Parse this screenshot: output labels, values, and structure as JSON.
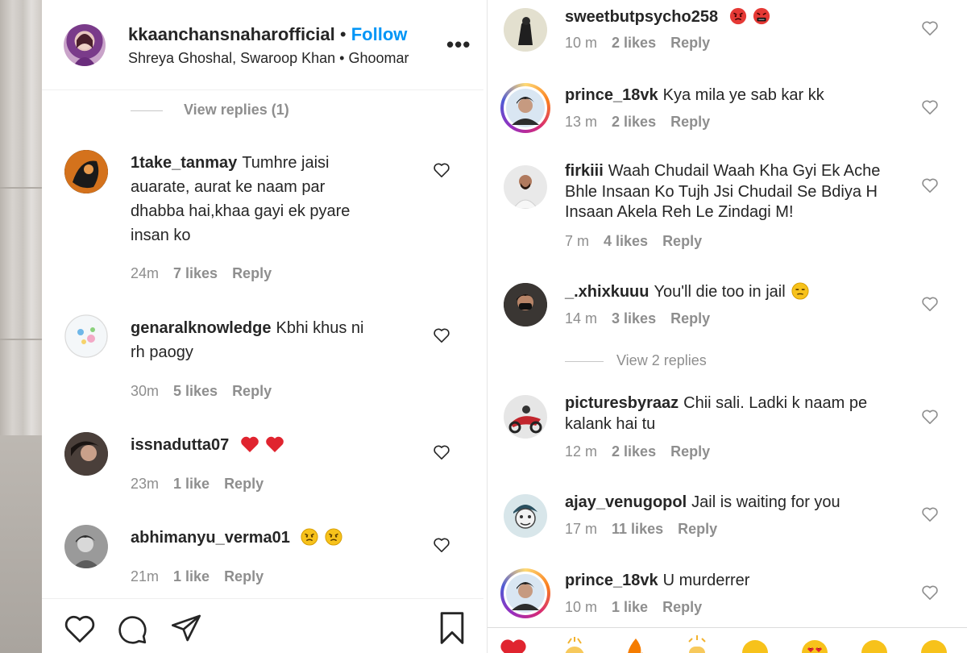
{
  "left": {
    "post": {
      "username": "kkaanchansnaharofficial",
      "separator": "•",
      "follow_label": "Follow",
      "audio": "Shreya Ghoshal, Swaroop Khan • Ghoomar",
      "more": "•••"
    },
    "view_replies": "View replies (1)",
    "comments": [
      {
        "user": "1take_tanmay",
        "text": "Tumhre jaisi",
        "lines": [
          "auarate, aurat ke naam par",
          "dhabba hai,khaa gayi ek pyare",
          "insan ko"
        ],
        "time": "24m",
        "likes": "7 likes",
        "reply": "Reply"
      },
      {
        "user": "genaralknowledge",
        "text": "Kbhi khus ni",
        "lines": [
          "rh paogy"
        ],
        "time": "30m",
        "likes": "5 likes",
        "reply": "Reply"
      },
      {
        "user": "issnadutta07",
        "text": "",
        "emoji": [
          "heart-emoji",
          "heart-emoji"
        ],
        "time": "23m",
        "likes": "1 like",
        "reply": "Reply"
      },
      {
        "user": "abhimanyu_verma01",
        "text": "",
        "emoji": [
          "angry-face-emoji",
          "angry-face-emoji"
        ],
        "time": "21m",
        "likes": "1 like",
        "reply": "Reply"
      }
    ],
    "actions": [
      "heart-icon",
      "comment-icon",
      "send-icon",
      "bookmark-icon"
    ]
  },
  "right": {
    "comments": [
      {
        "user": "sweetbutpsycho258",
        "text": "",
        "emoji": [
          "red-angry-face-emoji",
          "cursing-face-emoji"
        ],
        "time": "10 m",
        "likes": "2 likes",
        "reply": "Reply"
      },
      {
        "user": "prince_18vk",
        "text": "Kya mila ye sab kar kk",
        "time": "13 m",
        "likes": "2 likes",
        "reply": "Reply"
      },
      {
        "user": "firkiii",
        "text": "Waah Chudail Waah Kha Gyi Ek Ache",
        "lines": [
          "Bhle Insaan Ko Tujh Jsi Chudail Se Bdiya H",
          "Insaan Akela Reh Le Zindagi M!"
        ],
        "time": "7 m",
        "likes": "4 likes",
        "reply": "Reply"
      },
      {
        "user": "_.xhixkuuu",
        "text": "You'll die too in jail",
        "emoji": [
          "unamused-face-emoji"
        ],
        "time": "14 m",
        "likes": "3 likes",
        "reply": "Reply"
      },
      {
        "user": "picturesbyraaz",
        "text": "Chii sali. Ladki k naam pe",
        "lines": [
          "kalank hai tu"
        ],
        "time": "12 m",
        "likes": "2 likes",
        "reply": "Reply"
      },
      {
        "user": "ajay_venugopol",
        "text": "Jail is waiting for you",
        "time": "17 m",
        "likes": "11 likes",
        "reply": "Reply"
      },
      {
        "user": "prince_18vk",
        "text": "U murderrer",
        "time": "10 m",
        "likes": "1 like",
        "reply": "Reply"
      }
    ],
    "view_replies": "View 2 replies"
  },
  "colors": {
    "follow": "#0095f6",
    "muted": "#8e8e8e",
    "text": "#262626",
    "heart_red": "#ed4956"
  }
}
